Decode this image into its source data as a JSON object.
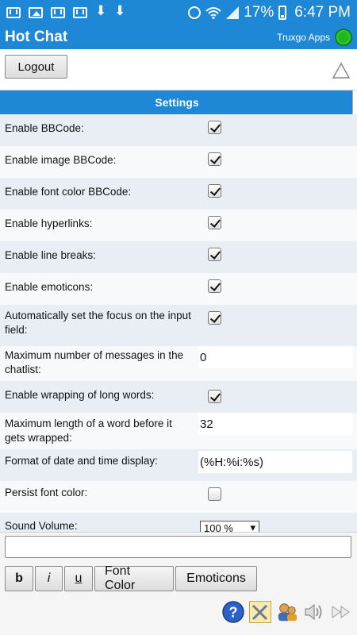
{
  "status_bar": {
    "battery_pct": "17%",
    "time": "6:47 PM"
  },
  "app": {
    "title": "Hot Chat",
    "publisher": "Truxgo Apps"
  },
  "toolbar": {
    "logout_label": "Logout"
  },
  "settings": {
    "title": "Settings",
    "rows": [
      {
        "label": "Enable BBCode:",
        "type": "checkbox",
        "checked": true
      },
      {
        "label": "Enable image BBCode:",
        "type": "checkbox",
        "checked": true
      },
      {
        "label": "Enable font color BBCode:",
        "type": "checkbox",
        "checked": true
      },
      {
        "label": "Enable hyperlinks:",
        "type": "checkbox",
        "checked": true
      },
      {
        "label": "Enable line breaks:",
        "type": "checkbox",
        "checked": true
      },
      {
        "label": "Enable emoticons:",
        "type": "checkbox",
        "checked": true
      },
      {
        "label": "Automatically set the focus on the input field:",
        "type": "checkbox",
        "checked": true
      },
      {
        "label": "Maximum number of messages in the chatlist:",
        "type": "text",
        "value": "0"
      },
      {
        "label": "Enable wrapping of long words:",
        "type": "checkbox",
        "checked": true
      },
      {
        "label": "Maximum length of a word before it gets wrapped:",
        "type": "text",
        "value": "32"
      },
      {
        "label": "Format of date and time display:",
        "type": "text",
        "value": "(%H:%i:%s)"
      },
      {
        "label": "Persist font color:",
        "type": "checkbox",
        "checked": false
      },
      {
        "label": "Sound Volume:",
        "type": "select",
        "value": "100 %"
      }
    ]
  },
  "composer": {
    "bold_label": "b",
    "italic_label": "i",
    "underline_label": "u",
    "font_color_label": "Font Color",
    "emoticons_label": "Emoticons"
  },
  "colors": {
    "accent": "#1e88d6",
    "online": "#22b522",
    "row_odd": "#e8eef4",
    "row_even": "#f7f9fb"
  }
}
